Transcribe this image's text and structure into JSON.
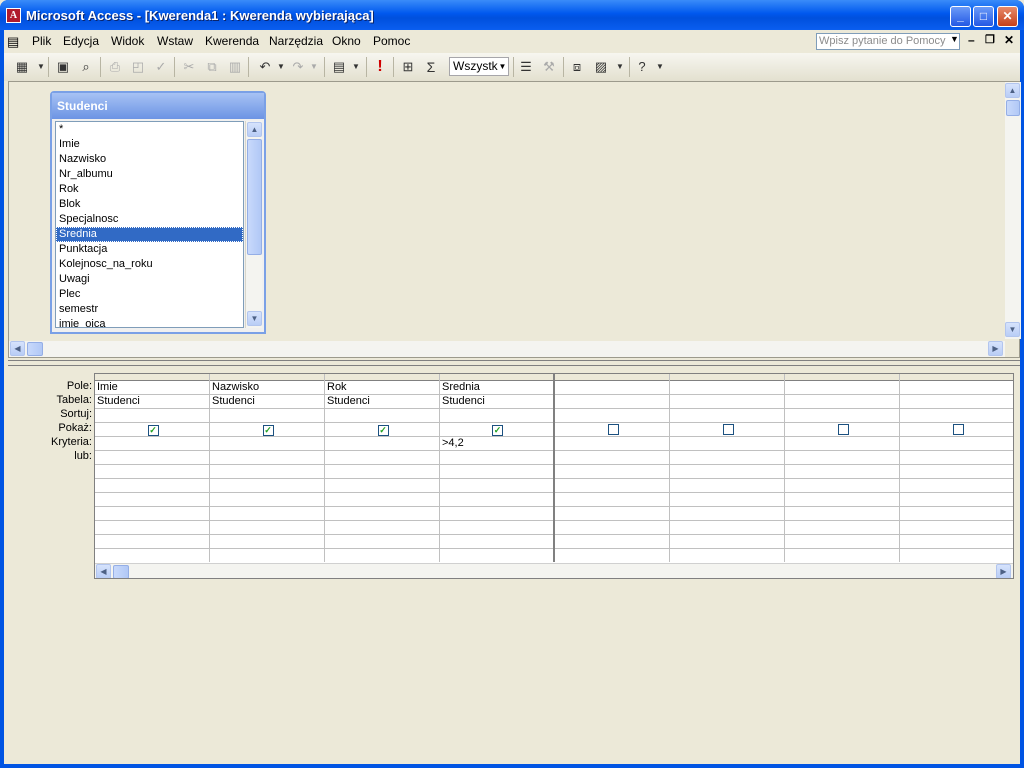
{
  "window": {
    "title": "Microsoft Access - [Kwerenda1 : Kwerenda wybierająca]",
    "app_icon": "access-key-icon",
    "controls": {
      "minimize": "_",
      "maximize": "□",
      "close": "✕"
    }
  },
  "menubar": {
    "items": [
      "Plik",
      "Edycja",
      "Widok",
      "Wstaw",
      "Kwerenda",
      "Narzędzia",
      "Okno",
      "Pomoc"
    ],
    "help_placeholder": "Wpisz pytanie do Pomocy"
  },
  "toolbar": {
    "top_values_value": "Wszystk",
    "buttons": [
      "view-icon",
      "save-icon",
      "search-icon",
      "print-icon",
      "print-preview-icon",
      "spelling-icon",
      "cut-icon",
      "copy-icon",
      "paste-icon",
      "undo-icon",
      "redo-icon",
      "query-type-icon",
      "run-icon",
      "show-table-icon",
      "totals-icon",
      "properties-icon",
      "build-icon",
      "database-window-icon",
      "new-object-icon",
      "help-icon"
    ]
  },
  "table": {
    "title": "Studenci",
    "fields": [
      "*",
      "Imie",
      "Nazwisko",
      "Nr_albumu",
      "Rok",
      "Blok",
      "Specjalnosc",
      "Srednia",
      "Punktacja",
      "Kolejnosc_na_roku",
      "Uwagi",
      "Plec",
      "semestr",
      "imie_ojca"
    ],
    "selected": "Srednia"
  },
  "grid": {
    "row_labels": [
      "Pole:",
      "Tabela:",
      "Sortuj:",
      "Pokaż:",
      "Kryteria:",
      "lub:"
    ],
    "columns": [
      {
        "pole": "Imie",
        "tabela": "Studenci",
        "sortuj": "",
        "pokaz": true,
        "kryteria": "",
        "lub": ""
      },
      {
        "pole": "Nazwisko",
        "tabela": "Studenci",
        "sortuj": "",
        "pokaz": true,
        "kryteria": "",
        "lub": ""
      },
      {
        "pole": "Rok",
        "tabela": "Studenci",
        "sortuj": "",
        "pokaz": true,
        "kryteria": "",
        "lub": ""
      },
      {
        "pole": "Srednia",
        "tabela": "Studenci",
        "sortuj": "",
        "pokaz": true,
        "kryteria": ">4,2",
        "lub": ""
      },
      {
        "pole": "",
        "tabela": "",
        "sortuj": "",
        "pokaz": false,
        "kryteria": "",
        "lub": ""
      },
      {
        "pole": "",
        "tabela": "",
        "sortuj": "",
        "pokaz": false,
        "kryteria": "",
        "lub": ""
      },
      {
        "pole": "",
        "tabela": "",
        "sortuj": "",
        "pokaz": false,
        "kryteria": "",
        "lub": ""
      },
      {
        "pole": "",
        "tabela": "",
        "sortuj": "",
        "pokaz": false,
        "kryteria": "",
        "lub": ""
      }
    ]
  }
}
